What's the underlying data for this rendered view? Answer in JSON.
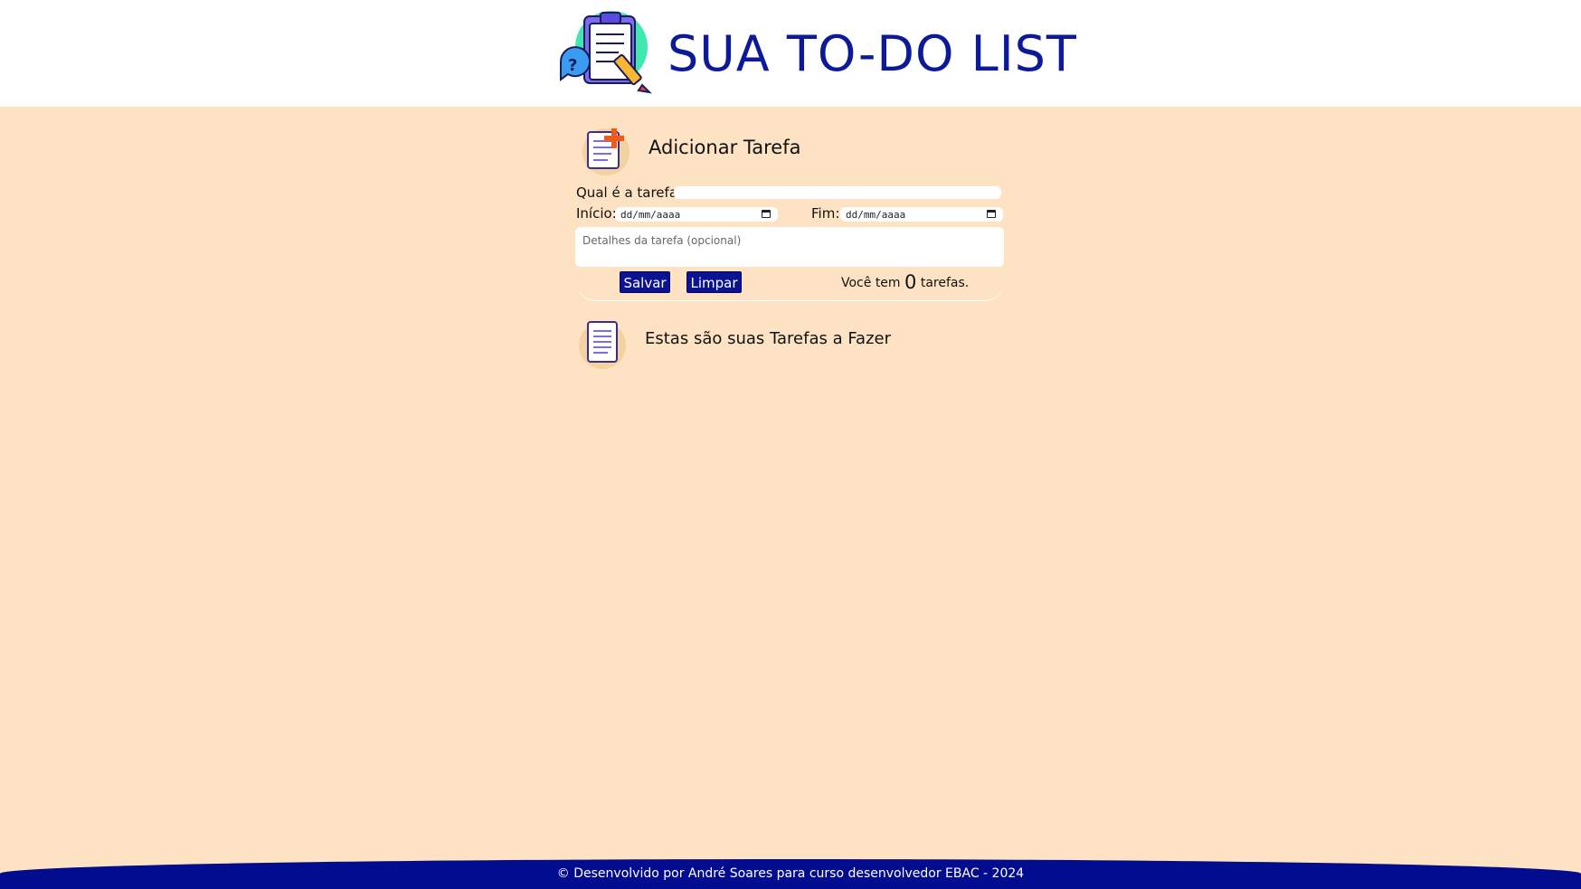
{
  "header": {
    "title": "SUA TO-DO LIST"
  },
  "add_section": {
    "title": "Adicionar Tarefa"
  },
  "form": {
    "task_label": "Qual é a tarefa?",
    "task_value": "",
    "start_label": "Início:",
    "start_placeholder": "dd/mm/aaaa",
    "end_label": "Fim:",
    "end_placeholder": "dd/mm/aaaa",
    "details_placeholder": "Detalhes da tarefa (opcional)",
    "save_label": "Salvar",
    "clear_label": "Limpar"
  },
  "counter": {
    "prefix": "Você tem",
    "count": "0",
    "suffix": "tarefas."
  },
  "list_section": {
    "title": "Estas são suas Tarefas a Fazer"
  },
  "footer": {
    "text": "© Desenvolvido por André Soares para curso desenvolvedor EBAC - 2024"
  },
  "colors": {
    "accent": "#0c1a9a",
    "background": "#fde3c3",
    "footer": "#020c8e",
    "button": "#0c1392"
  }
}
